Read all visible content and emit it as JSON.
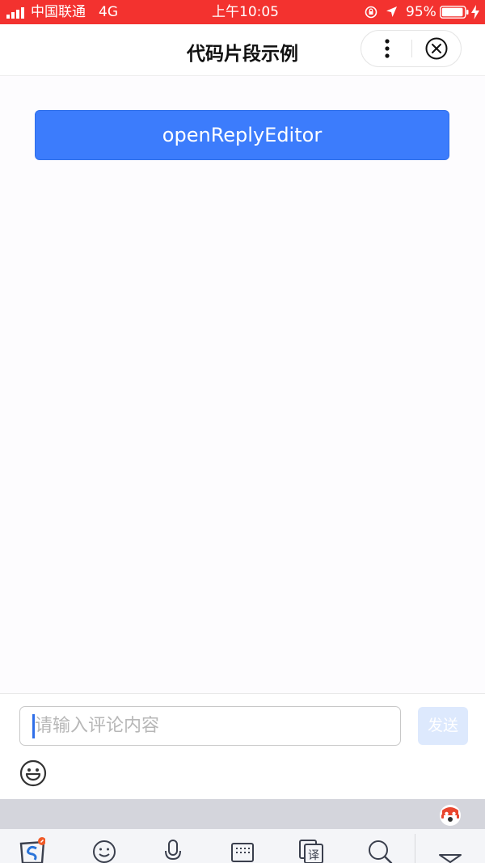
{
  "status_bar": {
    "carrier": "中国联通",
    "network": "4G",
    "time": "上午10:05",
    "battery": "95%",
    "battery_level": 0.95
  },
  "nav": {
    "title": "代码片段示例"
  },
  "main": {
    "button_label": "openReplyEditor"
  },
  "reply_editor": {
    "placeholder": "请输入评论内容",
    "send_label": "发送"
  },
  "colors": {
    "status_bar": "#f3322f",
    "primary": "#3c7cfc",
    "send_disabled": "#dde9fd"
  },
  "icons": {
    "status": [
      "signal-icon",
      "orientation-lock-icon",
      "location-arrow-icon",
      "battery-icon",
      "charging-bolt-icon"
    ],
    "nav": [
      "more-dots-icon",
      "close-circle-icon"
    ],
    "editor": [
      "emoji-icon"
    ],
    "keyboard": [
      "sogou-logo-icon",
      "emoji-face-icon",
      "microphone-icon",
      "keyboard-icon",
      "translate-icon",
      "search-icon",
      "collapse-keyboard-icon",
      "mascot-icon"
    ]
  }
}
